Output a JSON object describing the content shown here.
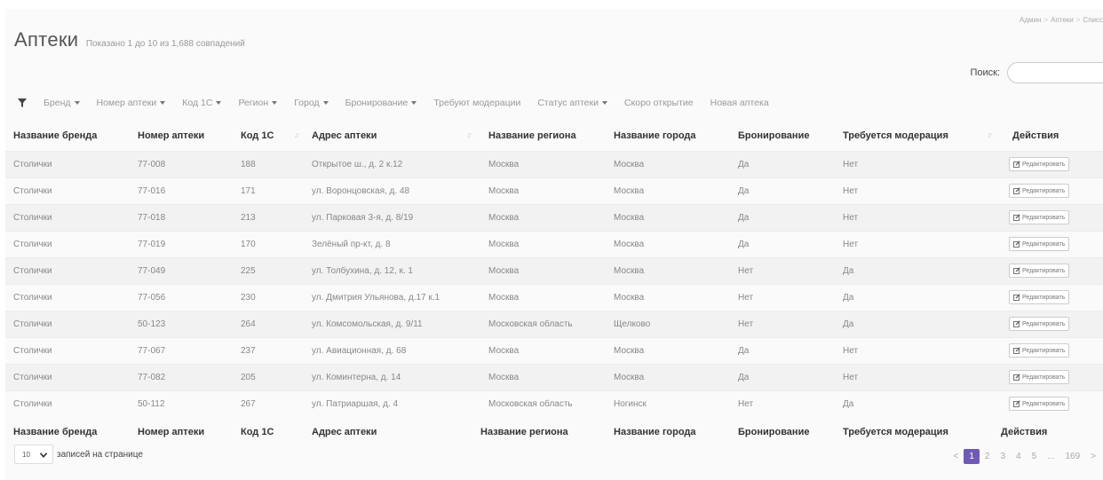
{
  "breadcrumb": [
    "Админ",
    "Аптеки",
    "Списс"
  ],
  "header": {
    "title": "Аптеки",
    "subtitle": "Показано 1 до 10 из 1,688 совпадений"
  },
  "search": {
    "label": "Поиск:",
    "value": "",
    "placeholder": ""
  },
  "filters": [
    {
      "label": "Бренд",
      "dropdown": true
    },
    {
      "label": "Номер аптеки",
      "dropdown": true
    },
    {
      "label": "Код 1С",
      "dropdown": true
    },
    {
      "label": "Регион",
      "dropdown": true
    },
    {
      "label": "Город",
      "dropdown": true
    },
    {
      "label": "Бронирование",
      "dropdown": true
    },
    {
      "label": "Требуют модерации",
      "dropdown": false
    },
    {
      "label": "Статус аптеки",
      "dropdown": true
    },
    {
      "label": "Скоро открытие",
      "dropdown": false
    },
    {
      "label": "Новая аптека",
      "dropdown": false
    }
  ],
  "table": {
    "columns": [
      "Название бренда",
      "Номер аптеки",
      "Код 1С",
      "Адрес аптеки",
      "Название региона",
      "Название города",
      "Бронирование",
      "Требуется модерация",
      "Действия"
    ],
    "edit_label": "Редактировать",
    "rows": [
      [
        "Столички",
        "77-008",
        "188",
        "Открытое ш., д. 2 к.12",
        "Москва",
        "Москва",
        "Да",
        "Нет"
      ],
      [
        "Столички",
        "77-016",
        "171",
        "ул. Воронцовская, д. 48",
        "Москва",
        "Москва",
        "Да",
        "Нет"
      ],
      [
        "Столички",
        "77-018",
        "213",
        "ул. Парковая 3-я, д. 8/19",
        "Москва",
        "Москва",
        "Да",
        "Нет"
      ],
      [
        "Столички",
        "77-019",
        "170",
        "Зелёный пр-кт, д. 8",
        "Москва",
        "Москва",
        "Да",
        "Нет"
      ],
      [
        "Столички",
        "77-049",
        "225",
        "ул. Толбухина, д. 12, к. 1",
        "Москва",
        "Москва",
        "Нет",
        "Да"
      ],
      [
        "Столички",
        "77-056",
        "230",
        "ул. Дмитрия Ульянова, д.17 к.1",
        "Москва",
        "Москва",
        "Нет",
        "Да"
      ],
      [
        "Столички",
        "50-123",
        "264",
        "ул. Комсомольская, д. 9/11",
        "Московская область",
        "Щелково",
        "Нет",
        "Да"
      ],
      [
        "Столички",
        "77-067",
        "237",
        "ул. Авиационная, д. 68",
        "Москва",
        "Москва",
        "Да",
        "Нет"
      ],
      [
        "Столички",
        "77-082",
        "205",
        "ул. Коминтерна, д. 14",
        "Москва",
        "Москва",
        "Да",
        "Нет"
      ],
      [
        "Столички",
        "50-112",
        "267",
        "ул. Патриаршая, д. 4",
        "Московская область",
        "Ногинск",
        "Нет",
        "Да"
      ]
    ]
  },
  "page_length": {
    "value": "10",
    "label": "записей на странице"
  },
  "pagination": {
    "prev": "<",
    "pages": [
      "1",
      "2",
      "3",
      "4",
      "5"
    ],
    "ellipsis": "...",
    "last": "169",
    "next": ">",
    "current": "1"
  },
  "colors": {
    "accent": "#6f5bb5"
  },
  "icons": [
    "filter-icon",
    "sort-icon",
    "pencil-edit-icon",
    "chevron-down-icon"
  ]
}
